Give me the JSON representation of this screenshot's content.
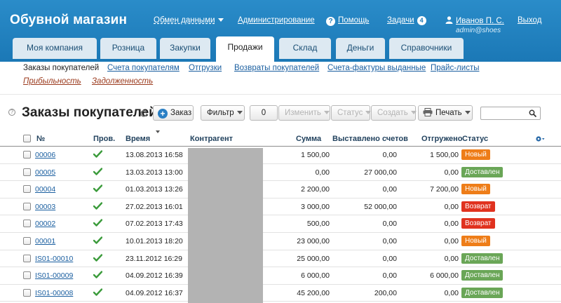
{
  "app": {
    "title": "Обувной магазин",
    "exchange_label": "Обмен данными",
    "admin_label": "Администрирование",
    "help_label": "Помощь",
    "tasks_label": "Задачи",
    "tasks_count": "4",
    "user_name": "Иванов П. С.",
    "user_login": "admin@shoes",
    "logout_label": "Выход"
  },
  "tabs": [
    {
      "label": "Моя компания"
    },
    {
      "label": "Розница"
    },
    {
      "label": "Закупки"
    },
    {
      "label": "Продажи",
      "active": true
    },
    {
      "label": "Склад"
    },
    {
      "label": "Деньги"
    },
    {
      "label": "Справочники"
    }
  ],
  "subnav": {
    "current": "Заказы покупателей",
    "links": [
      "Счета покупателям",
      "Отгрузки",
      "Возвраты покупателей",
      "Счета-фактуры выданные",
      "Прайс-листы"
    ],
    "reports": [
      "Прибыльность",
      "Задолженность"
    ]
  },
  "page": {
    "title": "Заказы покупателей",
    "order_button": "Заказ",
    "filter_button": "Фильтр",
    "selected_count": "0",
    "change_button": "Изменить",
    "status_button": "Статус",
    "create_button": "Создать",
    "print_button": "Печать",
    "search_placeholder": ""
  },
  "table": {
    "columns": {
      "number": "№",
      "checked": "Пров.",
      "time": "Время",
      "counterparty": "Контрагент",
      "sum": "Сумма",
      "invoiced": "Выставлено счетов",
      "shipped": "Отгружено",
      "status": "Статус"
    },
    "rows": [
      {
        "number": "00006",
        "time": "13.08.2013 16:58",
        "sum": "1 500,00",
        "invoiced": "0,00",
        "shipped": "1 500,00",
        "status": "Новый",
        "status_color": "#ee7d18"
      },
      {
        "number": "00005",
        "time": "13.03.2013 13:00",
        "sum": "0,00",
        "invoiced": "27 000,00",
        "shipped": "0,00",
        "status": "Доставлен",
        "status_color": "#6aa657"
      },
      {
        "number": "00004",
        "time": "01.03.2013 13:26",
        "sum": "2 200,00",
        "invoiced": "0,00",
        "shipped": "7 200,00",
        "status": "Новый",
        "status_color": "#ee7d18"
      },
      {
        "number": "00003",
        "time": "27.02.2013 16:01",
        "sum": "3 000,00",
        "invoiced": "52 000,00",
        "shipped": "0,00",
        "status": "Возврат",
        "status_color": "#e0321f"
      },
      {
        "number": "00002",
        "time": "07.02.2013 17:43",
        "sum": "500,00",
        "invoiced": "0,00",
        "shipped": "0,00",
        "status": "Возврат",
        "status_color": "#e0321f"
      },
      {
        "number": "00001",
        "time": "10.01.2013 18:20",
        "sum": "23 000,00",
        "invoiced": "0,00",
        "shipped": "0,00",
        "status": "Новый",
        "status_color": "#ee7d18"
      },
      {
        "number": "IS01-00010",
        "time": "23.11.2012 16:29",
        "sum": "25 000,00",
        "invoiced": "0,00",
        "shipped": "0,00",
        "status": "Доставлен",
        "status_color": "#6aa657"
      },
      {
        "number": "IS01-00009",
        "time": "04.09.2012 16:39",
        "sum": "6 000,00",
        "invoiced": "0,00",
        "shipped": "6 000,00",
        "status": "Доставлен",
        "status_color": "#6aa657"
      },
      {
        "number": "IS01-00008",
        "time": "04.09.2012 16:37",
        "sum": "45 200,00",
        "invoiced": "200,00",
        "shipped": "0,00",
        "status": "Доставлен",
        "status_color": "#6aa657"
      }
    ]
  },
  "colors": {
    "header": "#1b78b6",
    "tab_inactive": "#dde9f2",
    "link": "#1b5fa0",
    "check": "#3b9b3b"
  }
}
